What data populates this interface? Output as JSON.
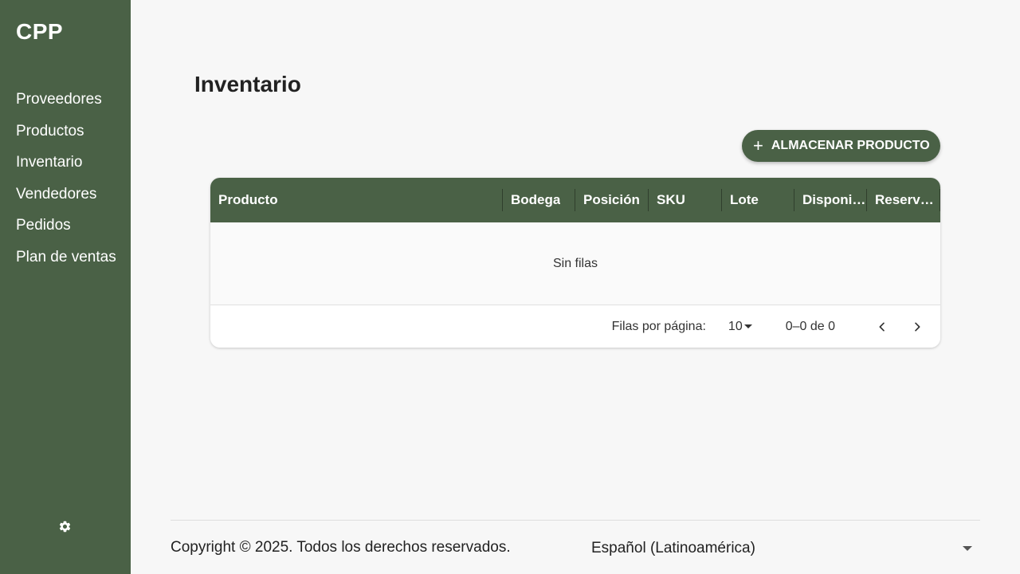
{
  "sidebar": {
    "brand": "CPP",
    "items": [
      {
        "label": "Proveedores"
      },
      {
        "label": "Productos"
      },
      {
        "label": "Inventario"
      },
      {
        "label": "Vendedores"
      },
      {
        "label": "Pedidos"
      },
      {
        "label": "Plan de ventas"
      }
    ],
    "settings_icon": "gear-icon"
  },
  "main": {
    "title": "Inventario",
    "add_button": {
      "label": "ALMACENAR PRODUCTO",
      "icon": "plus-icon"
    },
    "table": {
      "columns": [
        "Producto",
        "Bodega",
        "Posición",
        "SKU",
        "Lote",
        "Disponible",
        "Reservado"
      ],
      "empty_text": "Sin filas",
      "footer": {
        "rows_per_page_label": "Filas por página:",
        "rows_per_page_value": "10",
        "range": "0–0 de 0"
      }
    }
  },
  "footer": {
    "copyright": "Copyright © 2025. Todos los derechos reservados.",
    "language": "Español (Latinoamérica)"
  },
  "colors": {
    "brand": "#4a6146",
    "background": "#f7f7f7"
  }
}
